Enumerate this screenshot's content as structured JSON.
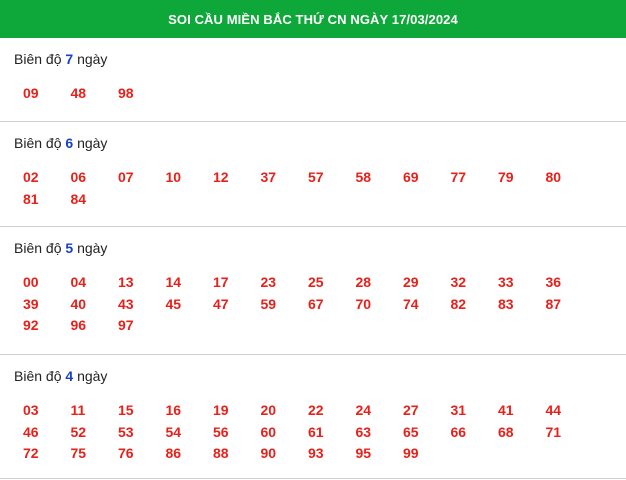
{
  "header": {
    "title": "SOI CẦU MIỀN BẮC THỨ CN NGÀY 17/03/2024"
  },
  "sections": [
    {
      "prefix": "Biên độ",
      "number": "7",
      "suffix": "ngày",
      "values": [
        "09",
        "48",
        "98"
      ]
    },
    {
      "prefix": "Biên độ",
      "number": "6",
      "suffix": "ngày",
      "values": [
        "02",
        "06",
        "07",
        "10",
        "12",
        "37",
        "57",
        "58",
        "69",
        "77",
        "79",
        "80",
        "81",
        "84"
      ]
    },
    {
      "prefix": "Biên độ",
      "number": "5",
      "suffix": "ngày",
      "values": [
        "00",
        "04",
        "13",
        "14",
        "17",
        "23",
        "25",
        "28",
        "29",
        "32",
        "33",
        "36",
        "39",
        "40",
        "43",
        "45",
        "47",
        "59",
        "67",
        "70",
        "74",
        "82",
        "83",
        "87",
        "92",
        "96",
        "97"
      ]
    },
    {
      "prefix": "Biên độ",
      "number": "4",
      "suffix": "ngày",
      "values": [
        "03",
        "11",
        "15",
        "16",
        "19",
        "20",
        "22",
        "24",
        "27",
        "31",
        "41",
        "44",
        "46",
        "52",
        "53",
        "54",
        "56",
        "60",
        "61",
        "63",
        "65",
        "66",
        "68",
        "71",
        "72",
        "75",
        "76",
        "86",
        "88",
        "90",
        "93",
        "95",
        "99"
      ]
    }
  ],
  "colors": {
    "header_bg": "#0ea739",
    "number_red": "#e8201a",
    "range_blue": "#1a3fc7"
  }
}
